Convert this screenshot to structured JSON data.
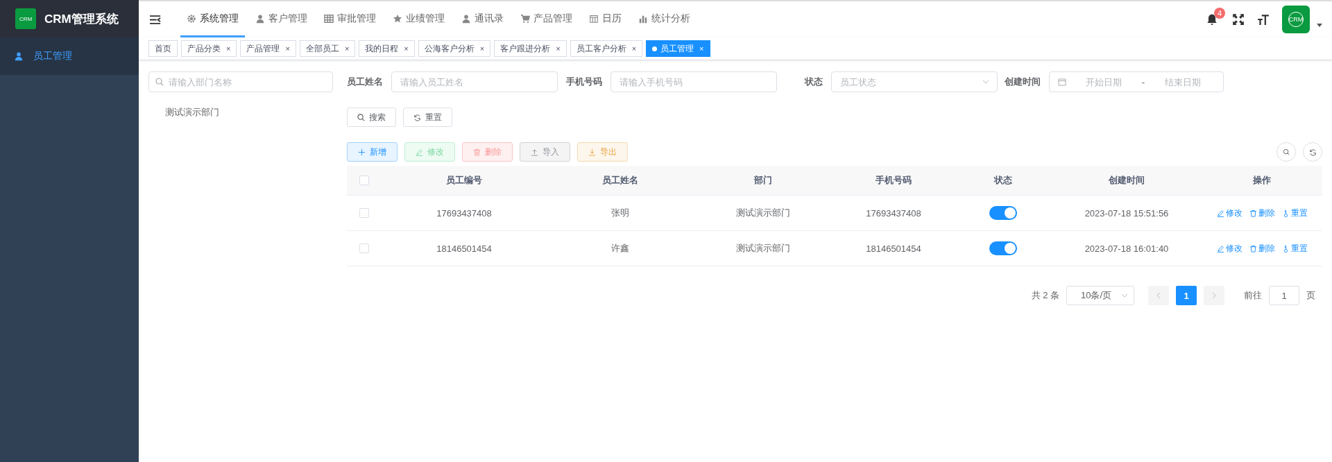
{
  "sidebar": {
    "logo_text": "CRM",
    "title": "CRM管理系统",
    "items": [
      {
        "label": "员工管理",
        "selected": true
      }
    ]
  },
  "topnav": {
    "items": [
      {
        "label": "系统管理",
        "kind": "gear",
        "selected": true
      },
      {
        "label": "客户管理",
        "kind": "person",
        "selected": false
      },
      {
        "label": "审批管理",
        "kind": "grid",
        "selected": false
      },
      {
        "label": "业绩管理",
        "kind": "star",
        "selected": false
      },
      {
        "label": "通讯录",
        "kind": "person",
        "selected": false
      },
      {
        "label": "产品管理",
        "kind": "cart",
        "selected": false
      },
      {
        "label": "日历",
        "kind": "calendar",
        "selected": false
      },
      {
        "label": "统计分析",
        "kind": "chart",
        "selected": false
      }
    ],
    "notification_count": "4",
    "avatar_text": "CRM"
  },
  "tags": [
    {
      "label": "首页",
      "closable": false,
      "selected": false
    },
    {
      "label": "产品分类",
      "closable": true,
      "selected": false
    },
    {
      "label": "产品管理",
      "closable": true,
      "selected": false
    },
    {
      "label": "全部员工",
      "closable": true,
      "selected": false
    },
    {
      "label": "我的日程",
      "closable": true,
      "selected": false
    },
    {
      "label": "公海客户分析",
      "closable": true,
      "selected": false
    },
    {
      "label": "客户跟进分析",
      "closable": true,
      "selected": false
    },
    {
      "label": "员工客户分析",
      "closable": true,
      "selected": false
    },
    {
      "label": "员工管理",
      "closable": true,
      "selected": true
    }
  ],
  "close_glyph": "×",
  "dept_panel": {
    "search_placeholder": "请输入部门名称",
    "tree": [
      {
        "label": "测试演示部门"
      }
    ]
  },
  "filters": [
    {
      "label": "员工姓名",
      "kind": "text",
      "placeholder": "请输入员工姓名"
    },
    {
      "label": "手机号码",
      "kind": "text",
      "placeholder": "请输入手机号码"
    },
    {
      "label": "状态",
      "kind": "select",
      "placeholder": "员工状态"
    },
    {
      "label": "创建时间",
      "kind": "daterange",
      "placeholder": "开始日期",
      "placeholder_end": "结束日期",
      "separator": "-"
    }
  ],
  "filter_buttons": [
    {
      "label": "搜索",
      "kind": "search"
    },
    {
      "label": "重置",
      "kind": "reset"
    }
  ],
  "toolbar": [
    {
      "label": "新增",
      "kind": "add"
    },
    {
      "label": "修改",
      "kind": "edit"
    },
    {
      "label": "删除",
      "kind": "delete"
    },
    {
      "label": "导入",
      "kind": "import"
    },
    {
      "label": "导出",
      "kind": "export"
    }
  ],
  "table": {
    "select_all_checked": false,
    "columns": [
      "员工编号",
      "员工姓名",
      "部门",
      "手机号码",
      "状态",
      "创建时间",
      "操作"
    ],
    "rows": [
      {
        "checked": false,
        "id": "17693437408",
        "name": "张明",
        "dept": "测试演示部门",
        "phone": "17693437408",
        "on": true,
        "created": "2023-07-18 15:51:56",
        "actions": [
          "修改",
          "删除",
          "重置"
        ]
      },
      {
        "checked": false,
        "id": "18146501454",
        "name": "许鑫",
        "dept": "测试演示部门",
        "phone": "18146501454",
        "on": true,
        "created": "2023-07-18 16:01:40",
        "actions": [
          "修改",
          "删除",
          "重置"
        ]
      }
    ]
  },
  "pagination": {
    "total": "共 2 条",
    "page_size": "10条/页",
    "pages": [
      {
        "label": "1",
        "selected": true
      }
    ],
    "goto_label": "前往",
    "goto_value": "1",
    "goto_suffix": "页"
  }
}
